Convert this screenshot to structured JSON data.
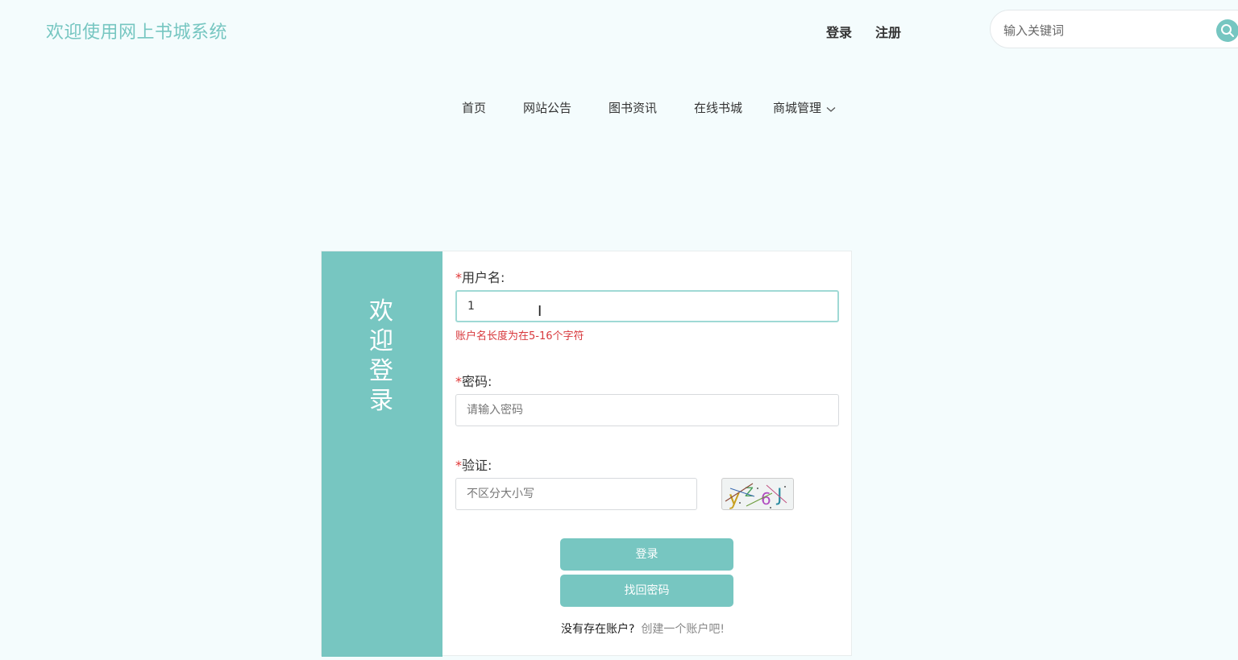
{
  "header": {
    "site_title": "欢迎使用网上书城系统",
    "login_link": "登录",
    "register_link": "注册",
    "search": {
      "placeholder": "输入关键词",
      "value": "",
      "icon": "search-icon"
    }
  },
  "nav": {
    "items": [
      {
        "label": "首页"
      },
      {
        "label": "网站公告"
      },
      {
        "label": "图书资讯"
      },
      {
        "label": "在线书城"
      },
      {
        "label": "商城管理",
        "icon": "chevron-down-icon"
      }
    ]
  },
  "login_form": {
    "side_title": "欢迎登录",
    "required_mark": "*",
    "username": {
      "label": "用户名:",
      "value": "1",
      "error": "账户名长度为在5-16个字符"
    },
    "password": {
      "label": "密码:",
      "placeholder": "请输入密码"
    },
    "captcha": {
      "label": "验证:",
      "placeholder": "不区分大小写"
    },
    "login_button": "登录",
    "recover_button": "找回密码",
    "no_account_text": "没有存在账户?",
    "create_account_link": "创建一个账户吧!"
  },
  "colors": {
    "accent": "#77c6c1",
    "background": "#f4fcfd",
    "error": "#d8383c"
  }
}
